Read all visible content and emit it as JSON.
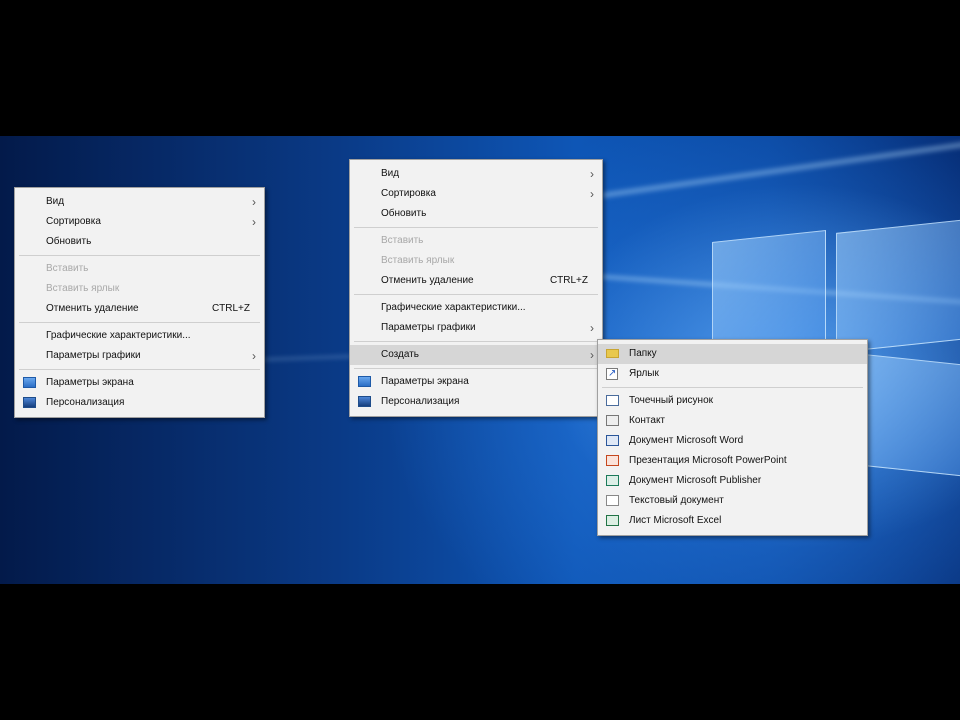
{
  "menu_left": {
    "items": [
      {
        "label": "Вид",
        "arrow": "›",
        "disabled": false
      },
      {
        "label": "Сортировка",
        "arrow": "›",
        "disabled": false
      },
      {
        "label": "Обновить",
        "disabled": false
      },
      {
        "sep": true
      },
      {
        "label": "Вставить",
        "disabled": true
      },
      {
        "label": "Вставить ярлык",
        "disabled": true
      },
      {
        "label": "Отменить удаление",
        "shortcut": "CTRL+Z",
        "disabled": false
      },
      {
        "sep": true
      },
      {
        "label": "Графические характеристики...",
        "disabled": false
      },
      {
        "label": "Параметры графики",
        "arrow": "›",
        "disabled": false
      },
      {
        "sep": true
      },
      {
        "label": "Параметры экрана",
        "icon": "display-settings-icon",
        "disabled": false
      },
      {
        "label": "Персонализация",
        "icon": "personalization-icon",
        "disabled": false
      }
    ]
  },
  "menu_middle": {
    "items": [
      {
        "label": "Вид",
        "arrow": "›",
        "disabled": false
      },
      {
        "label": "Сортировка",
        "arrow": "›",
        "disabled": false
      },
      {
        "label": "Обновить",
        "disabled": false
      },
      {
        "sep": true
      },
      {
        "label": "Вставить",
        "disabled": true
      },
      {
        "label": "Вставить ярлык",
        "disabled": true
      },
      {
        "label": "Отменить удаление",
        "shortcut": "CTRL+Z",
        "disabled": false
      },
      {
        "sep": true
      },
      {
        "label": "Графические характеристики...",
        "disabled": false
      },
      {
        "label": "Параметры графики",
        "arrow": "›",
        "disabled": false
      },
      {
        "sep": true
      },
      {
        "label": "Создать",
        "arrow": "›",
        "disabled": false,
        "hover": true
      },
      {
        "sep": true
      },
      {
        "label": "Параметры экрана",
        "icon": "display-settings-icon",
        "disabled": false
      },
      {
        "label": "Персонализация",
        "icon": "personalization-icon",
        "disabled": false
      }
    ]
  },
  "submenu_create": {
    "items": [
      {
        "label": "Папку",
        "icon": "folder-icon",
        "hover": true
      },
      {
        "label": "Ярлык",
        "icon": "shortcut-icon"
      },
      {
        "sep": true
      },
      {
        "label": "Точечный рисунок",
        "icon": "bitmap-icon"
      },
      {
        "label": "Контакт",
        "icon": "contact-icon"
      },
      {
        "label": "Документ Microsoft Word",
        "icon": "word-icon"
      },
      {
        "label": "Презентация Microsoft PowerPoint",
        "icon": "powerpoint-icon"
      },
      {
        "label": "Документ Microsoft Publisher",
        "icon": "publisher-icon"
      },
      {
        "label": "Текстовый документ",
        "icon": "text-document-icon"
      },
      {
        "label": "Лист Microsoft Excel",
        "icon": "excel-icon"
      }
    ]
  },
  "colors": {
    "menu_bg": "#f2f2f2",
    "hover_bg": "#d6d6d6",
    "disabled_text": "#a8a8a8",
    "wallpaper_accent": "#0e56b6"
  }
}
